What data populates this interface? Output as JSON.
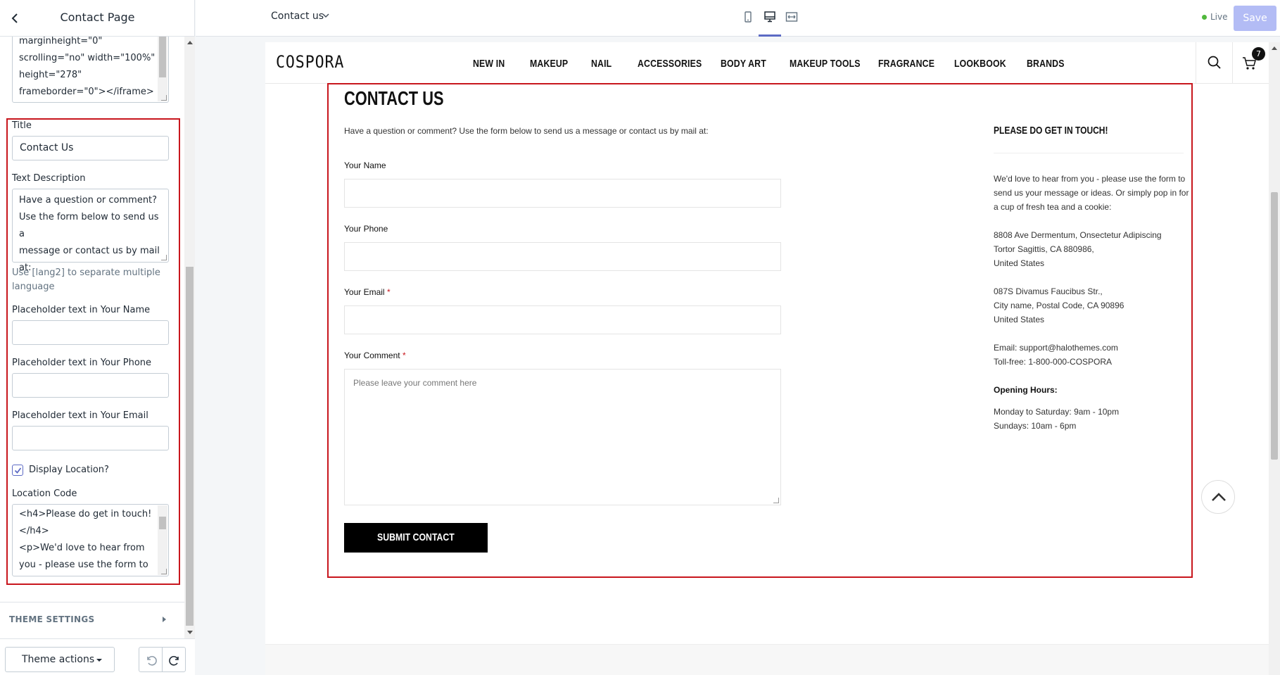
{
  "sidebar": {
    "title": "Contact Page",
    "iframe_code_lines": [
      "marginheight=\"0\"",
      "scrolling=\"no\" width=\"100%\"",
      "height=\"278\"",
      "frameborder=\"0\"></iframe>"
    ],
    "title_field": {
      "label": "Title",
      "value": "Contact Us"
    },
    "description_field": {
      "label": "Text Description",
      "lines": [
        "Have a question or comment?",
        "Use the form below to send us a",
        "message or contact us by mail",
        "at:"
      ],
      "help": "Use [lang2] to separate multiple language"
    },
    "placeholder_name": {
      "label": "Placeholder text in Your Name",
      "value": ""
    },
    "placeholder_phone": {
      "label": "Placeholder text in Your Phone",
      "value": ""
    },
    "placeholder_email": {
      "label": "Placeholder text in Your Email",
      "value": ""
    },
    "display_location": {
      "label": "Display Location?",
      "checked": true
    },
    "location_code": {
      "label": "Location Code",
      "lines": [
        "<h4>Please do get in touch!",
        "</h4>",
        "<p>We'd love to hear from",
        "you - please use the form to"
      ]
    },
    "theme_settings_label": "THEME SETTINGS",
    "theme_actions_label": "Theme actions"
  },
  "topbar": {
    "page_select": "Contact us",
    "live_label": "Live",
    "save_label": "Save",
    "active_view": "desktop"
  },
  "store": {
    "logo": "COSPORA",
    "nav": [
      "NEW IN",
      "MAKEUP",
      "NAIL",
      "ACCESSORIES",
      "BODY ART",
      "MAKEUP TOOLS",
      "FRAGRANCE",
      "LOOKBOOK",
      "BRANDS"
    ],
    "cart_count": "7"
  },
  "contact": {
    "title": "CONTACT US",
    "intro": "Have a question or comment? Use the form below to send us a message or contact us by mail at:",
    "name_label": "Your Name",
    "phone_label": "Your Phone",
    "email_label": "Your Email",
    "comment_label": "Your Comment",
    "required_mark": "*",
    "comment_placeholder": "Please leave your comment here",
    "submit_label": "SUBMIT CONTACT"
  },
  "location": {
    "title": "PLEASE DO GET IN TOUCH!",
    "intro": "We'd love to hear from you - please use the form to send us your message or ideas. Or simply pop in for a cup of fresh tea and a cookie:",
    "address1": [
      "8808 Ave Dermentum, Onsectetur Adipiscing",
      "Tortor Sagittis, CA 880986,",
      "United States"
    ],
    "address2": [
      "087S Divamus Faucibus Str.,",
      "City name, Postal Code, CA 90896",
      "United States"
    ],
    "email_line": "Email: support@halothemes.com",
    "tollfree_line": "Toll-free: 1-800-000-COSPORA",
    "hours_title": "Opening Hours:",
    "hours": [
      "Monday to Saturday: 9am - 10pm",
      "Sundays: 10am - 6pm"
    ]
  },
  "colors": {
    "highlight": "#c8161d",
    "accent": "#5c6ac4",
    "save_disabled": "#b3bcf5",
    "live": "#50b83c"
  }
}
